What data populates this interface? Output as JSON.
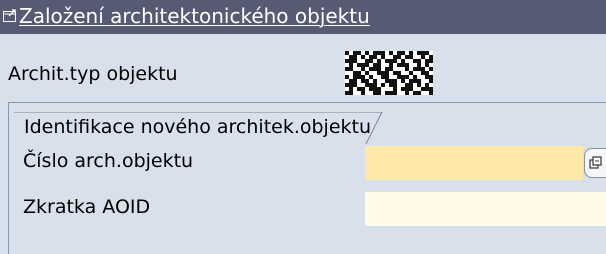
{
  "window": {
    "title": "Založení architektonického objektu",
    "title_icon": "sap-window-icon",
    "colors": {
      "titlebar": "#565a73",
      "panel": "#d8e0ec",
      "required_field": "#ffe9a8",
      "optional_field": "#fffbe8"
    }
  },
  "header": {
    "type_label": "Archit.typ objektu",
    "type_value_icon": "pixelated-image-icon"
  },
  "group": {
    "title": "Identifikace nového architek.objektu",
    "fields": [
      {
        "label": "Číslo arch.objektu",
        "value": "",
        "required": true,
        "help_icon": "search-help-icon"
      },
      {
        "label": "Zkratka AOID",
        "value": "",
        "required": false
      }
    ]
  }
}
